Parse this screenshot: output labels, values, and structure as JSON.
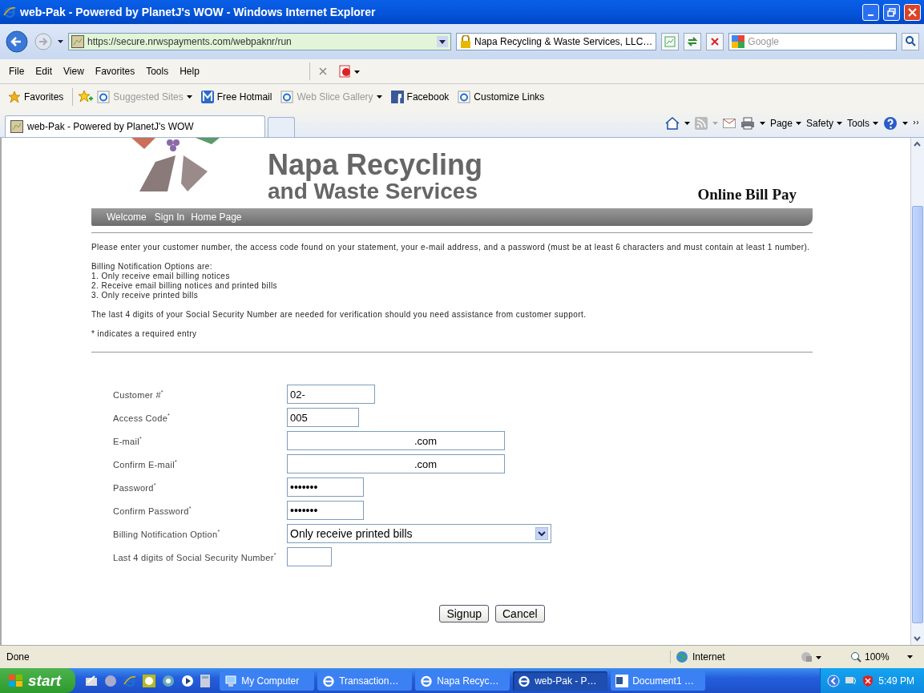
{
  "window": {
    "title": "web-Pak - Powered by PlanetJ's WOW - Windows Internet Explorer"
  },
  "address_bar": {
    "url": "https://secure.nrwspayments.com/webpaknr/run",
    "security_label": "Napa Recycling & Waste Services, LLC…",
    "search_placeholder": "Google"
  },
  "menu": [
    "File",
    "Edit",
    "View",
    "Favorites",
    "Tools",
    "Help"
  ],
  "favorites_bar": {
    "label": "Favorites",
    "links": [
      {
        "label": "Suggested Sites",
        "dimmed": true,
        "dropdown": true
      },
      {
        "label": "Free Hotmail",
        "dimmed": false,
        "dropdown": false
      },
      {
        "label": "Web Slice Gallery",
        "dimmed": true,
        "dropdown": true
      },
      {
        "label": "Facebook",
        "dimmed": false,
        "dropdown": false
      },
      {
        "label": "Customize Links",
        "dimmed": false,
        "dropdown": false
      }
    ]
  },
  "tabs": [
    {
      "label": "web-Pak - Powered by PlanetJ's WOW",
      "selected": true
    }
  ],
  "command_bar": [
    "Page",
    "Safety",
    "Tools"
  ],
  "page": {
    "logo_line_1": "Napa Recycling",
    "logo_line_2": "and Waste Services",
    "subtitle": "Online Bill Pay",
    "nav": [
      "Welcome",
      "Sign In",
      "Home Page"
    ],
    "intro": [
      "Please enter your customer number, the access code found on your statement, your e-mail address, and a password (must be at least 6 characters and must contain at least 1 number).",
      "Billing Notification Options are:",
      "1. Only receive email billing notices",
      "2. Receive email billing notices and printed bills",
      "3. Only receive printed bills",
      "The last 4 digits of your Social Security Number are needed for verification should you need assistance from customer support.",
      "* indicates a required entry"
    ],
    "fields": [
      {
        "label": "Customer #$^{*}$",
        "kind": "text",
        "value": "02-"
      },
      {
        "label": "Access Code$^{*}$",
        "kind": "text",
        "value": "005"
      },
      {
        "label": "E-mail$^{*}$",
        "kind": "redacted",
        "value": ".com"
      },
      {
        "label": "Confirm E-mail$^{*}$",
        "kind": "redacted",
        "value": ".com"
      },
      {
        "label": "Password$^{*}$",
        "kind": "password",
        "value": "•••••••"
      },
      {
        "label": "Confirm Password$^{*}$",
        "kind": "password",
        "value": "•••••••"
      },
      {
        "label": "Billing Notification Option$^{*}$",
        "kind": "select",
        "value": "Only receive printed bills"
      },
      {
        "label": "Last 4 digits of Social Security Number$^{*}$",
        "kind": "text"
      }
    ],
    "buttons": [
      "Signup",
      "Cancel"
    ]
  },
  "status_bar": {
    "text": "Done",
    "zone": "Internet",
    "zoom": "100%"
  },
  "taskbar": {
    "start": "start",
    "tasks": [
      {
        "label": "My Computer",
        "selected": false,
        "kind": "folder"
      },
      {
        "label": "Transaction…",
        "selected": false,
        "kind": "browser"
      },
      {
        "label": "Napa Recyc…",
        "selected": false,
        "kind": "browser"
      },
      {
        "label": "web-Pak - P…",
        "selected": true,
        "kind": "browser"
      },
      {
        "label": "Document1 …",
        "selected": false,
        "kind": "document"
      }
    ],
    "clock": "5:49 PM"
  }
}
